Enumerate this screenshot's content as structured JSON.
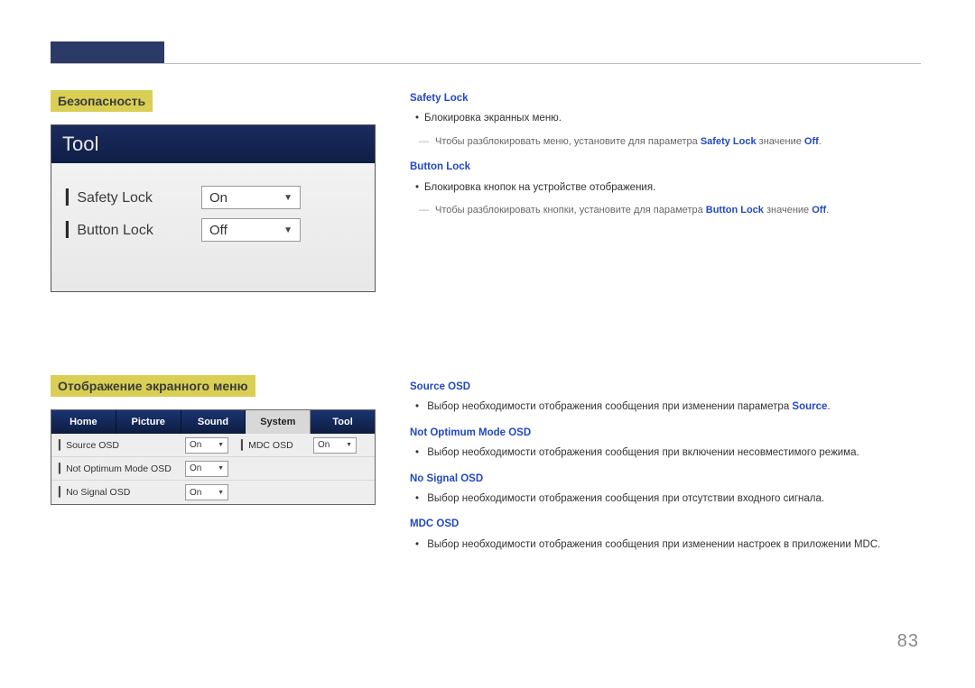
{
  "page_number": "83",
  "section1": {
    "heading": "Безопасность",
    "panel_title": "Tool",
    "rows": [
      {
        "label": "Safety Lock",
        "value": "On"
      },
      {
        "label": "Button Lock",
        "value": "Off"
      }
    ]
  },
  "right1": {
    "items": [
      {
        "title": "Safety Lock",
        "bullet": "Блокировка экранных меню.",
        "note_pre": "Чтобы разблокировать меню, установите для параметра ",
        "note_term": "Safety Lock",
        "note_mid": " значение ",
        "note_val": "Off",
        "note_post": "."
      },
      {
        "title": "Button Lock",
        "bullet": "Блокировка кнопок на устройстве отображения.",
        "note_pre": "Чтобы разблокировать кнопки, установите для параметра ",
        "note_term": "Button Lock",
        "note_mid": " значение ",
        "note_val": "Off",
        "note_post": "."
      }
    ]
  },
  "section2": {
    "heading": "Отображение экранного меню",
    "tabs": [
      "Home",
      "Picture",
      "Sound",
      "System",
      "Tool"
    ],
    "active_tab": 3,
    "rows": [
      {
        "label": "Source OSD",
        "value": "On",
        "label2": "MDC OSD",
        "value2": "On"
      },
      {
        "label": "Not Optimum Mode OSD",
        "value": "On"
      },
      {
        "label": "No Signal OSD",
        "value": "On"
      }
    ]
  },
  "right2": {
    "items": [
      {
        "title": "Source OSD",
        "bullet_pre": "Выбор необходимости отображения сообщения при изменении параметра ",
        "bullet_term": "Source",
        "bullet_post": "."
      },
      {
        "title": "Not Optimum Mode OSD",
        "bullet_pre": "Выбор необходимости отображения сообщения при включении несовместимого режима.",
        "bullet_term": "",
        "bullet_post": ""
      },
      {
        "title": "No Signal OSD",
        "bullet_pre": "Выбор необходимости отображения сообщения при отсутствии входного сигнала.",
        "bullet_term": "",
        "bullet_post": ""
      },
      {
        "title": "MDC OSD",
        "bullet_pre": "Выбор необходимости отображения сообщения при изменении настроек в приложении MDC.",
        "bullet_term": "",
        "bullet_post": ""
      }
    ]
  }
}
